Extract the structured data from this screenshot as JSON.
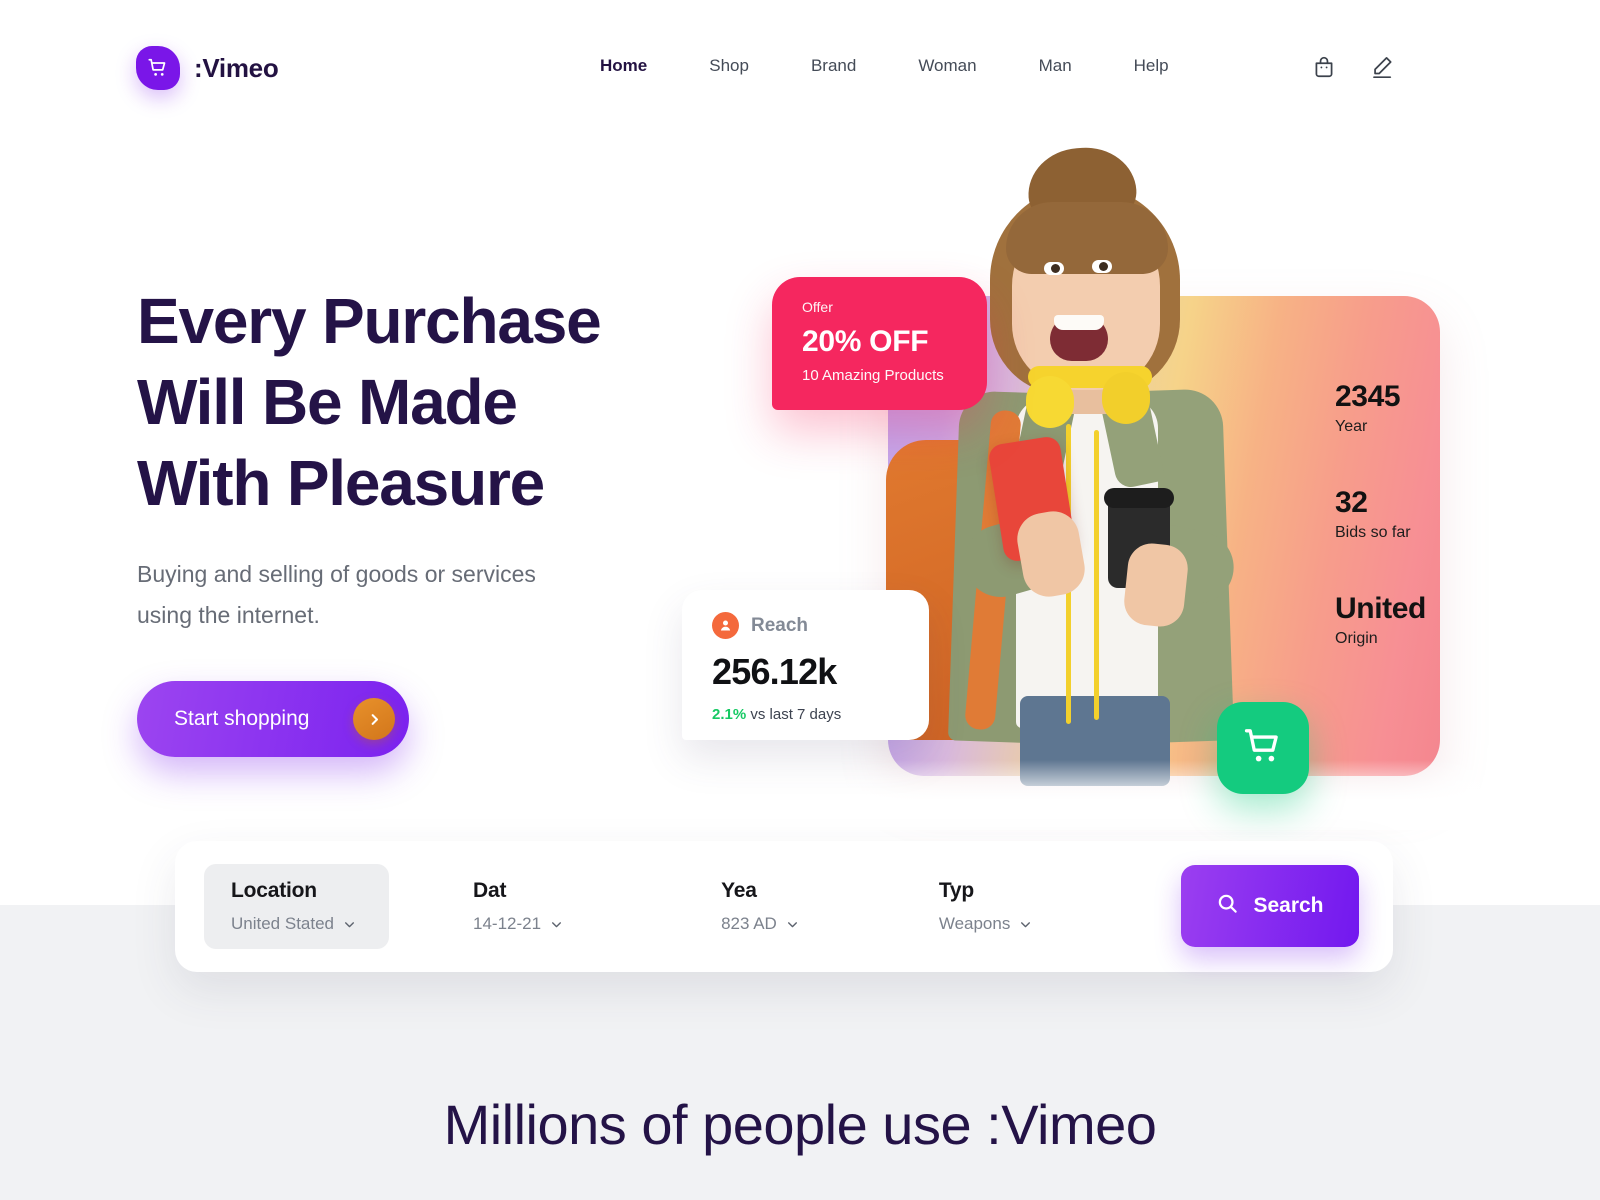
{
  "brand": {
    "name": ":Vimeo",
    "mark_icon": "shopping-cart-icon",
    "mark_color": "#7a16e8"
  },
  "nav": {
    "items": [
      {
        "label": "Home",
        "active": true
      },
      {
        "label": "Shop",
        "active": false
      },
      {
        "label": "Brand",
        "active": false
      },
      {
        "label": "Woman",
        "active": false
      },
      {
        "label": "Man",
        "active": false
      },
      {
        "label": "Help",
        "active": false
      }
    ],
    "icons": [
      {
        "name": "bag-icon"
      },
      {
        "name": "pen-icon"
      }
    ]
  },
  "hero": {
    "title_line1": "Every Purchase",
    "title_line2": "Will Be Made",
    "title_line3": "With Pleasure",
    "subtitle_line1": "Buying and selling of goods or services",
    "subtitle_line2": "using the internet.",
    "cta_label": "Start shopping",
    "cta_icon": "chevron-right-icon",
    "cta_color": "#7b22ef",
    "cta_arrow_color": "#e8912b"
  },
  "offer_card": {
    "eyebrow": "Offer",
    "value": "20% OFF",
    "note": "10 Amazing Products",
    "color": "#f5275f"
  },
  "reach_card": {
    "avatar_icon": "person-icon",
    "title": "Reach",
    "value": "256.12k",
    "delta": "2.1%",
    "delta_suffix": "vs last 7 days",
    "delta_color": "#17c964"
  },
  "stats": [
    {
      "value": "2345",
      "label": "Year"
    },
    {
      "value": "32",
      "label": "Bids so far"
    },
    {
      "value": "United",
      "label": "Origin"
    }
  ],
  "cart_fab": {
    "icon": "shopping-cart-icon",
    "color": "#14cb7f"
  },
  "search_bar": {
    "fields": [
      {
        "label": "Location",
        "value": "United Stated",
        "caret": "chevron-down-icon"
      },
      {
        "label": "Dat",
        "value": "14-12-21",
        "caret": "chevron-down-icon"
      },
      {
        "label": "Yea",
        "value": "823 AD",
        "caret": "chevron-down-icon"
      },
      {
        "label": "Typ",
        "value": "Weapons",
        "caret": "chevron-down-icon"
      }
    ],
    "button_label": "Search",
    "button_icon": "search-icon",
    "button_color": "#7218ef"
  },
  "bottom_heading": "Millions of people use :Vimeo"
}
